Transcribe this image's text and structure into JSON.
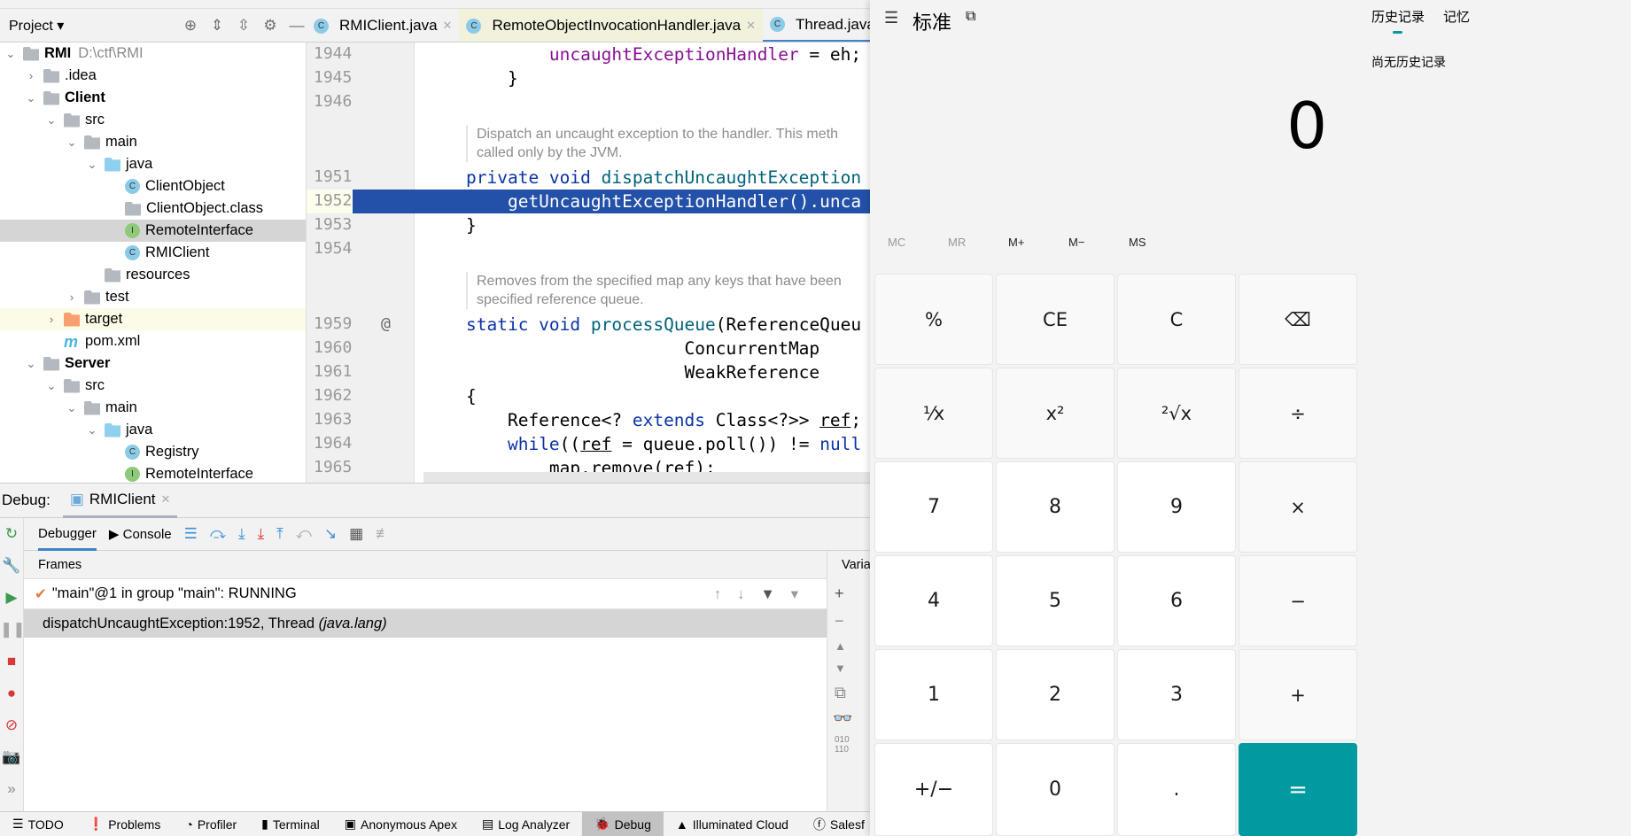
{
  "project": {
    "title": "Project",
    "tree": [
      {
        "label": "RMI",
        "hint": "D:\\ctf\\RMI",
        "depth": 0,
        "arrow": "v",
        "icon": "module",
        "bold": true
      },
      {
        "label": ".idea",
        "depth": 1,
        "arrow": ">",
        "icon": "folder"
      },
      {
        "label": "Client",
        "depth": 1,
        "arrow": "v",
        "icon": "module",
        "bold": true
      },
      {
        "label": "src",
        "depth": 2,
        "arrow": "v",
        "icon": "folder"
      },
      {
        "label": "main",
        "depth": 3,
        "arrow": "v",
        "icon": "folder"
      },
      {
        "label": "java",
        "depth": 4,
        "arrow": "v",
        "icon": "src"
      },
      {
        "label": "ClientObject",
        "depth": 5,
        "arrow": "",
        "icon": "cls"
      },
      {
        "label": "ClientObject.class",
        "depth": 5,
        "arrow": "",
        "icon": "folder"
      },
      {
        "label": "RemoteInterface",
        "depth": 5,
        "arrow": "",
        "icon": "intf",
        "selected": true
      },
      {
        "label": "RMIClient",
        "depth": 5,
        "arrow": "",
        "icon": "cls"
      },
      {
        "label": "resources",
        "depth": 4,
        "arrow": "",
        "icon": "folder"
      },
      {
        "label": "test",
        "depth": 3,
        "arrow": ">",
        "icon": "folder"
      },
      {
        "label": "target",
        "depth": 2,
        "arrow": ">",
        "icon": "orange",
        "highlight": true
      },
      {
        "label": "pom.xml",
        "depth": 2,
        "arrow": "",
        "icon": "m"
      },
      {
        "label": "Server",
        "depth": 1,
        "arrow": "v",
        "icon": "module",
        "bold": true
      },
      {
        "label": "src",
        "depth": 2,
        "arrow": "v",
        "icon": "folder"
      },
      {
        "label": "main",
        "depth": 3,
        "arrow": "v",
        "icon": "folder"
      },
      {
        "label": "java",
        "depth": 4,
        "arrow": "v",
        "icon": "src"
      },
      {
        "label": "Registry",
        "depth": 5,
        "arrow": "",
        "icon": "cls"
      },
      {
        "label": "RemoteInterface",
        "depth": 5,
        "arrow": "",
        "icon": "intf"
      }
    ]
  },
  "editor": {
    "tabs": [
      {
        "label": "RMIClient.java"
      },
      {
        "label": "RemoteObjectInvocationHandler.java"
      },
      {
        "label": "Thread.java"
      }
    ],
    "lines": [
      {
        "n": "1944",
        "tokens": [
          [
            "        ",
            ""
          ],
          [
            "uncaughtExceptionHandler",
            "fld"
          ],
          [
            " = eh;",
            ""
          ]
        ]
      },
      {
        "n": "1945",
        "tokens": [
          [
            "    }",
            ""
          ]
        ]
      },
      {
        "n": "1946",
        "tokens": []
      },
      {
        "doc": [
          "Dispatch an uncaught exception to the handler. This meth",
          "called only by the JVM."
        ]
      },
      {
        "n": "1951",
        "tokens": [
          [
            "private void ",
            "kw"
          ],
          [
            "dispatchUncaughtException",
            "fn"
          ]
        ]
      },
      {
        "n": "1952",
        "current": true,
        "tokens": [
          [
            "    getUncaughtExceptionHandler().unca",
            ""
          ]
        ]
      },
      {
        "n": "1953",
        "tokens": [
          [
            "}",
            ""
          ]
        ]
      },
      {
        "n": "1954",
        "tokens": []
      },
      {
        "doc": [
          "Removes from the specified map any keys that have been",
          "specified reference queue."
        ]
      },
      {
        "n": "1959",
        "mark": "@",
        "tokens": [
          [
            "static void ",
            "kw"
          ],
          [
            "processQueue",
            "fn"
          ],
          [
            "(ReferenceQueu",
            ""
          ]
        ]
      },
      {
        "n": "1960",
        "tokens": [
          [
            "                     ConcurrentMap",
            ""
          ]
        ]
      },
      {
        "n": "1961",
        "tokens": [
          [
            "                     WeakReference",
            ""
          ]
        ]
      },
      {
        "n": "1962",
        "tokens": [
          [
            "{",
            ""
          ]
        ]
      },
      {
        "n": "1963",
        "tokens": [
          [
            "    Reference<? ",
            ""
          ],
          [
            "extends",
            "kw"
          ],
          [
            " Class<?>> ",
            ""
          ],
          [
            "ref",
            "ul"
          ],
          [
            ";",
            ""
          ]
        ]
      },
      {
        "n": "1964",
        "tokens": [
          [
            "    ",
            ""
          ],
          [
            "while",
            "kw"
          ],
          [
            "((",
            ""
          ],
          [
            "ref",
            "ul"
          ],
          [
            " = queue.poll()) != ",
            ""
          ],
          [
            "null",
            "kw"
          ]
        ]
      },
      {
        "n": "1965",
        "tokens": [
          [
            "        map.remove(",
            ""
          ],
          [
            "ref",
            "ul"
          ],
          [
            ");",
            ""
          ]
        ]
      }
    ]
  },
  "debug": {
    "label": "Debug:",
    "session": "RMIClient",
    "tabs": {
      "debugger": "Debugger",
      "console": "Console"
    },
    "frames_title": "Frames",
    "variables_title": "Varia",
    "thread": "\"main\"@1 in group \"main\": RUNNING",
    "frame": {
      "method": "dispatchUncaughtException:1952, Thread",
      "pkg": "(java.lang)"
    }
  },
  "statusbar": [
    "TODO",
    "Problems",
    "Profiler",
    "Terminal",
    "Anonymous Apex",
    "Log Analyzer",
    "Debug",
    "Illuminated Cloud",
    "Salesf"
  ],
  "statusbar_active": "Debug",
  "calculator": {
    "mode": "标准",
    "display": "0",
    "history_tab": "历史记录",
    "memory_tab": "记忆",
    "history_empty": "尚无历史记录",
    "memory": [
      {
        "label": "MC",
        "enabled": false
      },
      {
        "label": "MR",
        "enabled": false
      },
      {
        "label": "M+",
        "enabled": true
      },
      {
        "label": "M−",
        "enabled": true
      },
      {
        "label": "MS",
        "enabled": true
      }
    ],
    "keys": [
      [
        "%",
        "CE",
        "C",
        "⌫"
      ],
      [
        "¹⁄x",
        "x²",
        "²√x",
        "÷"
      ],
      [
        "7",
        "8",
        "9",
        "×"
      ],
      [
        "4",
        "5",
        "6",
        "−"
      ],
      [
        "1",
        "2",
        "3",
        "+"
      ],
      [
        "+/−",
        "0",
        ".",
        "="
      ]
    ],
    "accent": "#019aa1"
  }
}
